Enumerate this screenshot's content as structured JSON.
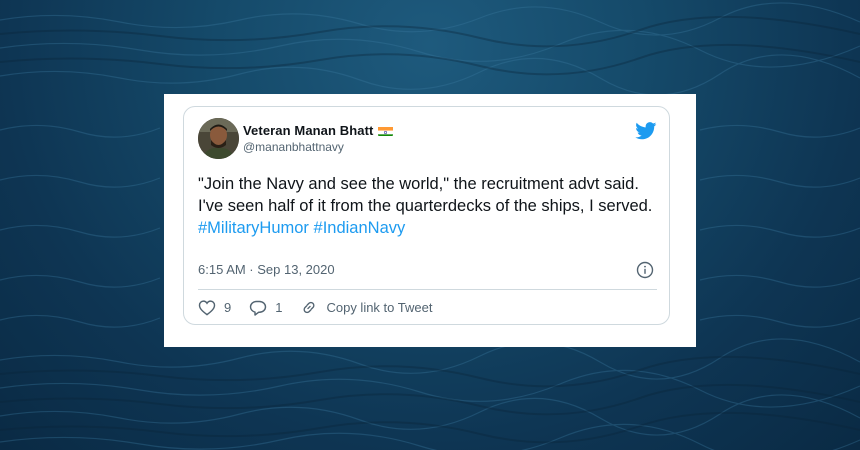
{
  "tweet": {
    "display_name": "Veteran Manan Bhatt",
    "handle": "@mananbhattnavy",
    "text": "\"Join the Navy and see the world,\" the recruitment advt said. I've seen half of it from the quarterdecks of the ships, I served.",
    "hashtags": [
      "#MilitaryHumor",
      "#IndianNavy"
    ],
    "timestamp": "6:15 AM · Sep 13, 2020",
    "likes": "9",
    "replies": "1",
    "copy_link_label": "Copy link to Tweet"
  },
  "icons": {
    "brand": "twitter-bird-icon",
    "flag": "india-flag-icon",
    "info": "info-icon",
    "like": "heart-icon",
    "reply": "reply-bubble-icon",
    "copy": "link-icon"
  },
  "colors": {
    "accent": "#1d9bf0",
    "text": "#0f1419",
    "muted": "#536471",
    "border": "#cfd9de",
    "background": "#154a6a"
  }
}
